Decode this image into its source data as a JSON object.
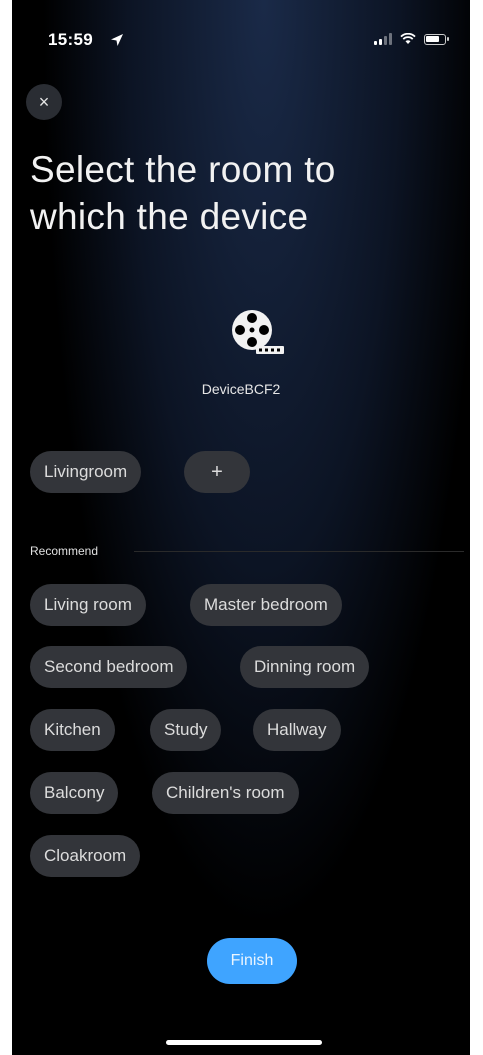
{
  "status_bar": {
    "time": "15:59"
  },
  "close_label": "×",
  "title": "Select the room to which the device",
  "device": {
    "name": "DeviceBCF2",
    "icon": "film-reel-icon"
  },
  "rooms": [
    {
      "label": "Livingroom"
    },
    {
      "label": "+"
    }
  ],
  "recommend": {
    "label": "Recommend",
    "items": [
      "Living room",
      "Master bedroom",
      "Second bedroom",
      "Dinning room",
      "Kitchen",
      "Study",
      "Hallway",
      "Balcony",
      "Children's room",
      "Cloakroom"
    ]
  },
  "finish_label": "Finish",
  "colors": {
    "accent": "#3fa4ff",
    "chip_bg": "#33353a",
    "background": "#000000"
  }
}
